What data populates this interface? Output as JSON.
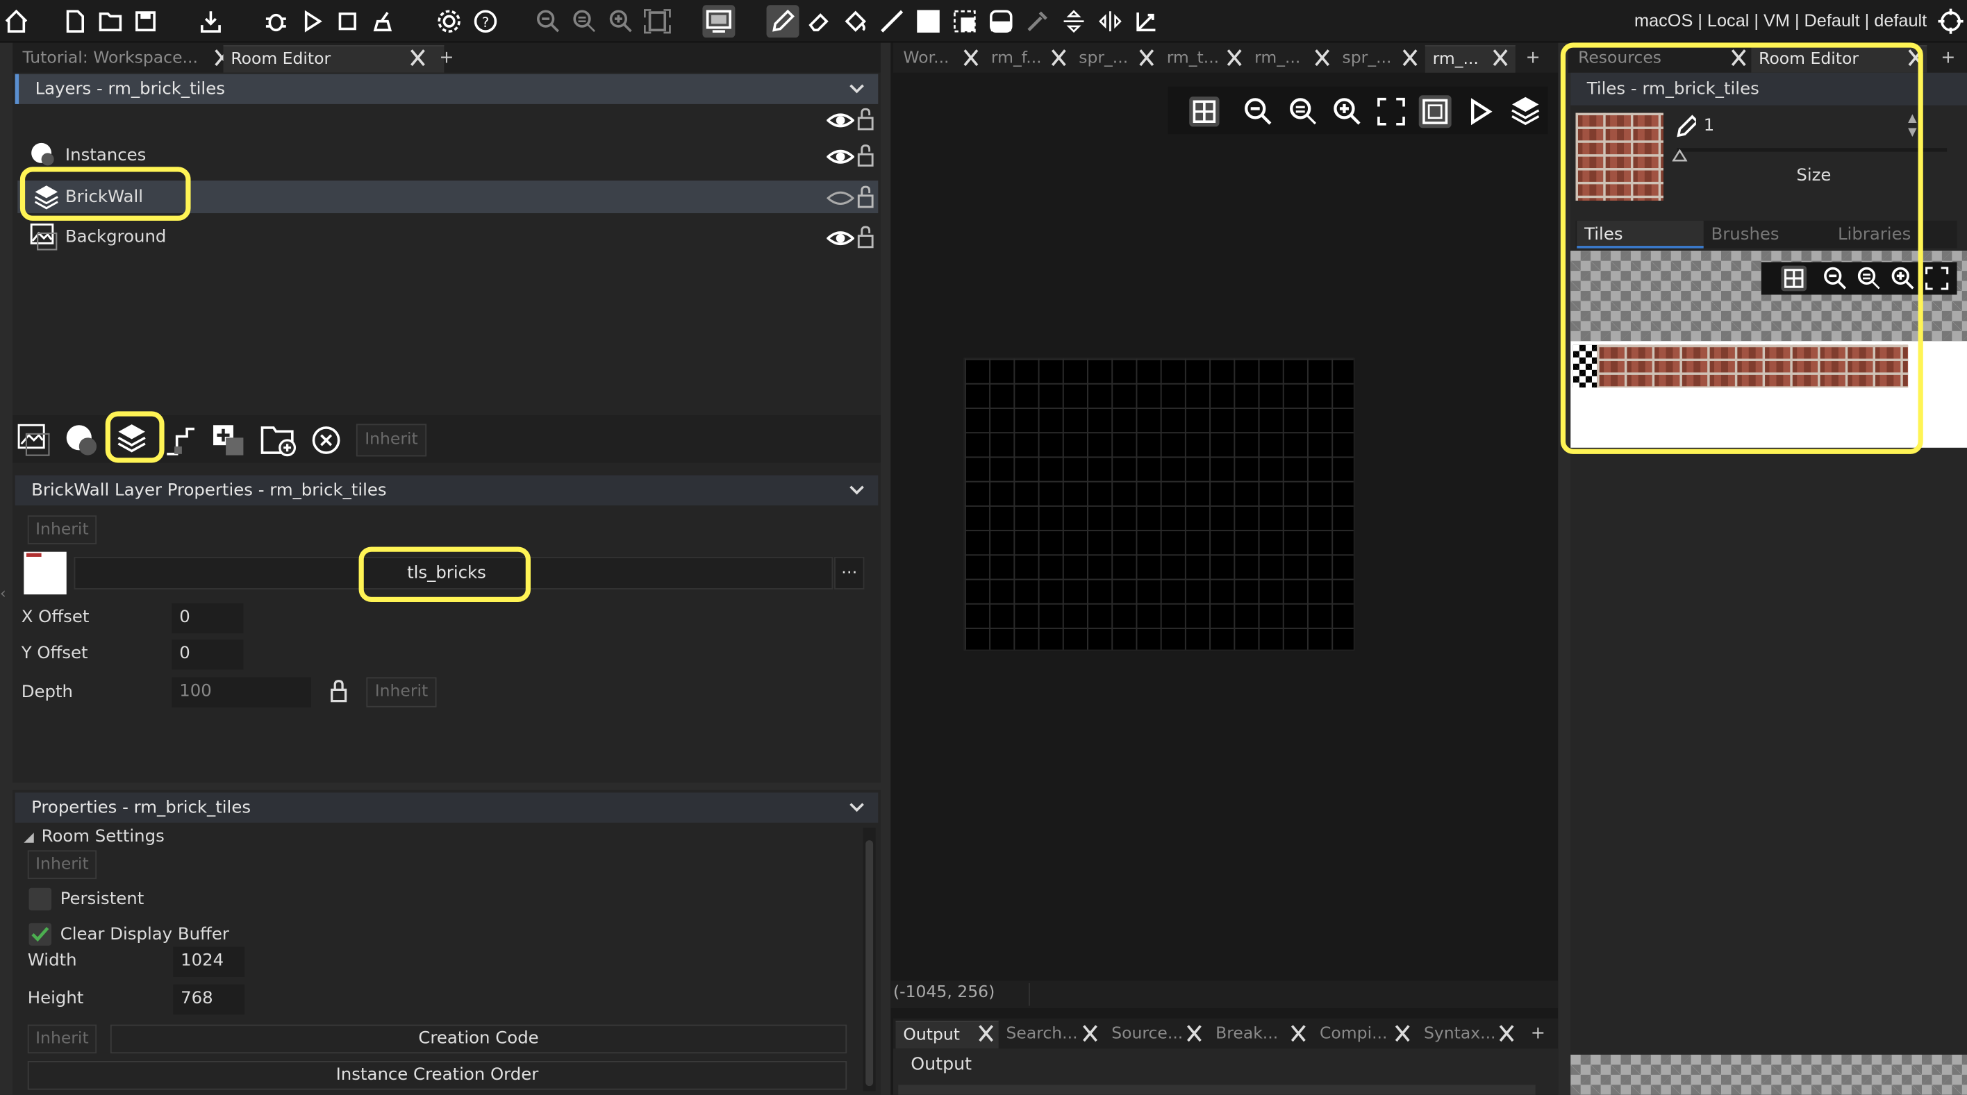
{
  "toolbar": {
    "target_info": "macOS | Local | VM | Default | default",
    "icons": [
      "home-icon",
      "new-file-icon",
      "open-folder-icon",
      "save-icon",
      "export-icon",
      "debug-icon",
      "run-icon",
      "stop-icon",
      "clean-icon",
      "settings-icon",
      "help-icon",
      "zoom-out-icon",
      "zoom-reset-icon",
      "zoom-in-icon",
      "fit-icon",
      "display-icon",
      "pencil-icon",
      "eraser-icon",
      "fill-icon",
      "line-icon",
      "rectangle-icon",
      "select-icon",
      "toggle-icon",
      "picker-icon",
      "flip-vertical-icon",
      "flip-horizontal-icon",
      "rotate-icon",
      "target-icon"
    ]
  },
  "left_tabs": {
    "items": [
      "Tutorial: Workspace...",
      "Room Editor"
    ],
    "plus": "+"
  },
  "layers": {
    "header": "Layers - rm_brick_tiles",
    "items": [
      {
        "name": "Instances"
      },
      {
        "name": "BrickWall"
      },
      {
        "name": "Background"
      }
    ],
    "inherit": "Inherit"
  },
  "layer_props": {
    "header": "BrickWall Layer Properties - rm_brick_tiles",
    "inherit": "Inherit",
    "tileset": "tls_bricks",
    "more": "···",
    "x_offset_label": "X Offset",
    "x_offset": "0",
    "y_offset_label": "Y Offset",
    "y_offset": "0",
    "depth_label": "Depth",
    "depth": "100",
    "depth_inherit": "Inherit"
  },
  "room_props": {
    "header": "Properties - rm_brick_tiles",
    "room_settings": "Room Settings",
    "inherit": "Inherit",
    "persistent": "Persistent",
    "clear_display": "Clear Display Buffer",
    "width_label": "Width",
    "width": "1024",
    "height_label": "Height",
    "height": "768",
    "inherit2": "Inherit",
    "creation_code": "Creation Code",
    "instance_order": "Instance Creation Order"
  },
  "center_tabs": {
    "items": [
      "Wor...",
      "rm_f...",
      "spr_...",
      "rm_t...",
      "rm_...",
      "spr_...",
      "rm_..."
    ],
    "plus": "+"
  },
  "canvas": {
    "coords": "(-1045, 256)"
  },
  "output_tabs": {
    "items": [
      "Output",
      "Search...",
      "Source...",
      "Break...",
      "Compi...",
      "Syntax..."
    ],
    "plus": "+"
  },
  "output": {
    "title": "Output"
  },
  "right_tabs": {
    "items": [
      "Resources",
      "Room Editor"
    ],
    "plus": "+"
  },
  "tiles": {
    "header": "Tiles - rm_brick_tiles",
    "brush_size": "1",
    "size_label": "Size",
    "subtabs": [
      "Tiles",
      "Brushes",
      "Libraries"
    ]
  }
}
